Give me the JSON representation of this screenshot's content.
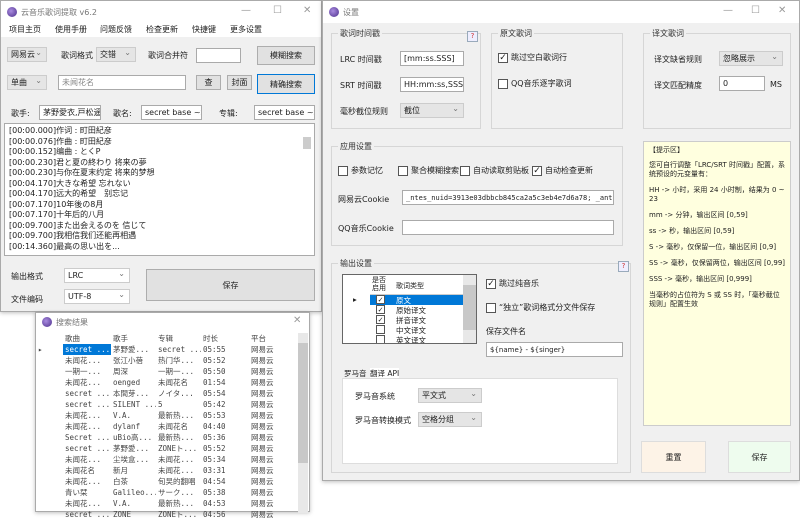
{
  "main": {
    "title": "云音乐歌词提取 v6.2",
    "menu": [
      "项目主页",
      "使用手册",
      "问题反馈",
      "检查更新",
      "快捷键",
      "更多设置"
    ],
    "source": "网易云",
    "lyric_format_label": "歌词格式",
    "lyric_format": "交错",
    "merge_label": "歌词合并符",
    "merge_value": "",
    "fuzzy_search": "模糊搜索",
    "search_type": "单曲",
    "search_placeholder": "未闻花名",
    "query_btn": "查",
    "cover_btn": "封面",
    "exact_search": "精确搜索",
    "singer_label": "歌手:",
    "singer": "茅野愛衣,戸松遥",
    "song_label": "歌名:",
    "song": "secret base ~君がくれたもの~",
    "album_label": "专辑:",
    "album": "secret base ~君がくれたもの~",
    "lyrics": [
      "[00:00.000]作词 : 町田紀彦",
      "[00:00.076]作曲 : 町田紀彦",
      "[00:00.152]编曲 : とくP",
      "[00:00.230]君と夏の終わり 将来の夢",
      "[00:00.230]与你在夏末约定 将来的梦想",
      "[00:04.170]大きな希望 忘れない",
      "[00:04.170]远大的希望　别忘记",
      "[00:07.170]10年後の8月",
      "[00:07.170]十年后的八月",
      "[00:09.700]また出会えるのを 信じて",
      "[00:09.700]我相信我们还能再相遇",
      "[00:14.360]最高の思い出を..."
    ],
    "output_format_label": "输出格式",
    "output_format": "LRC",
    "encoding_label": "文件编码",
    "encoding": "UTF-8",
    "save": "保存"
  },
  "results": {
    "title": "搜索结果",
    "columns": [
      "歌曲",
      "歌手",
      "专辑",
      "时长",
      "平台"
    ],
    "rows": [
      [
        "secret ...",
        "茅野愛...",
        "secret ...",
        "05:55",
        "网易云"
      ],
      [
        "未闻花...",
        "张江小蓓",
        "热门华...",
        "05:52",
        "网易云"
      ],
      [
        "一期一...",
        "周深",
        "一期一...",
        "05:50",
        "网易云"
      ],
      [
        "未闻花...",
        "oenged",
        "未闻花名",
        "01:54",
        "网易云"
      ],
      [
        "secret ...",
        "本間芽...",
        "ノイタ...",
        "05:54",
        "网易云"
      ],
      [
        "secret ...",
        "SILENT ...",
        "5",
        "05:42",
        "网易云"
      ],
      [
        "未闻花...",
        "V.A.",
        "最新热...",
        "05:53",
        "网易云"
      ],
      [
        "未闻花...",
        "dylanf",
        "未闻花名",
        "04:40",
        "网易云"
      ],
      [
        "Secret ...",
        "uBio高...",
        "最新热...",
        "05:36",
        "网易云"
      ],
      [
        "secret ...",
        "茅野愛...",
        "ZONEト...",
        "05:52",
        "网易云"
      ],
      [
        "未闻花...",
        "尘埃盒...",
        "未闻花...",
        "05:34",
        "网易云"
      ],
      [
        "未闻花名",
        "新月",
        "未闻花...",
        "03:31",
        "网易云"
      ],
      [
        "未闻花...",
        "白茶",
        "旬旲的翻唱",
        "04:54",
        "网易云"
      ],
      [
        "青い栞",
        "Galileo...",
        "サーク...",
        "05:38",
        "网易云"
      ],
      [
        "未闻花...",
        "V.A.",
        "最新热...",
        "04:53",
        "网易云"
      ],
      [
        "secret ...",
        "ZONE",
        "ZONEト...",
        "04:56",
        "网易云"
      ]
    ]
  },
  "settings": {
    "title": "设置",
    "timestamp": {
      "title": "歌词时间戳",
      "lrc_label": "LRC 时间戳",
      "lrc": "[mm:ss.SSS]",
      "srt_label": "SRT 时间戳",
      "srt": "HH:mm:ss,SSS",
      "ms_label": "毫秒截位规则",
      "ms": "截位",
      "help": "?"
    },
    "original": {
      "title": "原文歌词",
      "skip_blank": "跳过空白歌词行",
      "skip_blank_checked": true,
      "qq_word": "QQ音乐逐字歌词",
      "qq_word_checked": false
    },
    "translation": {
      "title": "译文歌词",
      "missing_label": "译文缺省规则",
      "missing": "忽略展示",
      "precision_label": "译文匹配精度",
      "precision": "0",
      "unit": "MS"
    },
    "app": {
      "title": "应用设置",
      "options": [
        {
          "label": "参数记忆",
          "checked": false
        },
        {
          "label": "聚合模糊搜索",
          "checked": false
        },
        {
          "label": "自动读取剪贴板",
          "checked": false
        },
        {
          "label": "自动检查更新",
          "checked": true
        }
      ],
      "netease_cookie_label": "网易云Cookie",
      "netease_cookie": "_ntes_nuid=3913e03dbbcb845ca2a5c3eb4e7d6a78; _antanal",
      "qq_cookie_label": "QQ音乐Cookie",
      "qq_cookie": ""
    },
    "output": {
      "title": "输出设置",
      "help": "?",
      "col_enabled": "是否启用",
      "col_type": "歌词类型",
      "types": [
        {
          "label": "原文",
          "checked": true
        },
        {
          "label": "原始译文",
          "checked": true
        },
        {
          "label": "拼音译文",
          "checked": true
        },
        {
          "label": "中文译文",
          "checked": false
        },
        {
          "label": "英文译文",
          "checked": false
        },
        {
          "label": "罗马音译文",
          "checked": false
        }
      ],
      "skip_pure_music": "跳过纯音乐",
      "skip_pure_music_checked": true,
      "separate": "“独立”歌词格式分文件保存",
      "separate_checked": false,
      "filename_label": "保存文件名",
      "filename": "${name} - ${singer}"
    },
    "tabs": [
      "罗马音",
      "翻译 API"
    ],
    "romaji": {
      "system_label": "罗马音系统",
      "system": "平文式",
      "mode_label": "罗马音转换模式",
      "mode": "空格分组"
    },
    "hint": {
      "title": "【提示区】",
      "lines": [
        "您可自行调整「LRC/SRT 时间戳」配置，系统预设的元变量有：",
        "HH -> 小时，采用 24 小时制，结果为 0 ~ 23",
        "mm -> 分钟，输出区间 [0,59]",
        "ss -> 秒，输出区间 [0,59]",
        "S -> 毫秒，仅保留一位，输出区间 [0,9]",
        "SS -> 毫秒，仅保留两位，输出区间 [0,99]",
        "SSS -> 毫秒，输出区间 [0,999]",
        "当毫秒的占位符为 S 或 SS 时，「毫秒截位规则」配置生效"
      ]
    },
    "reset": "重置",
    "save": "保存",
    "reset_color": "#fdf3e7",
    "save_color": "#eefcee",
    "hint_bg": "#ffffdf"
  }
}
